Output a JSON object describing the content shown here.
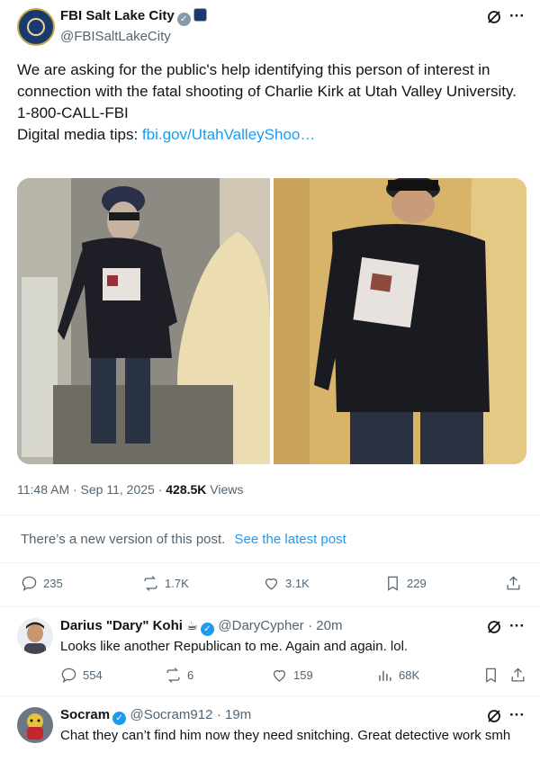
{
  "post": {
    "author_name": "FBI Salt Lake City",
    "author_handle": "@FBISaltLakeCity",
    "text_line1": "We are asking for the public's help identifying this person of interest in connection with the fatal shooting of Charlie Kirk at Utah Valley University.",
    "text_line2": "1-800-CALL-FBI",
    "text_line3_prefix": "Digital media tips: ",
    "text_link": "fbi.gov/UtahValleyShoo…",
    "timestamp": "11:48 AM · Sep 11, 2025 · ",
    "views_count": "428.5K",
    "views_label": " Views",
    "notice_text": "There’s a new version of this post.",
    "notice_link": "See the latest post",
    "stats": {
      "replies": "235",
      "reposts": "1.7K",
      "likes": "3.1K",
      "bookmarks": "229"
    }
  },
  "replies": [
    {
      "name": "Darius \"Dary\" Kohi",
      "emoji": "☕",
      "handle": "@DaryCypher",
      "time": "· 20m",
      "text": "Looks like another Republican to me. Again and again. lol.",
      "stats": {
        "replies": "554",
        "reposts": "6",
        "likes": "159",
        "views": "68K"
      }
    },
    {
      "name": "Socram",
      "handle": "@Socram912",
      "time": "· 19m",
      "text": "Chat they can’t find him now they need snitching. Great detective work smh"
    }
  ],
  "colors": {
    "accent": "#1d9bf0",
    "muted": "#536471",
    "text": "#0f1419"
  }
}
